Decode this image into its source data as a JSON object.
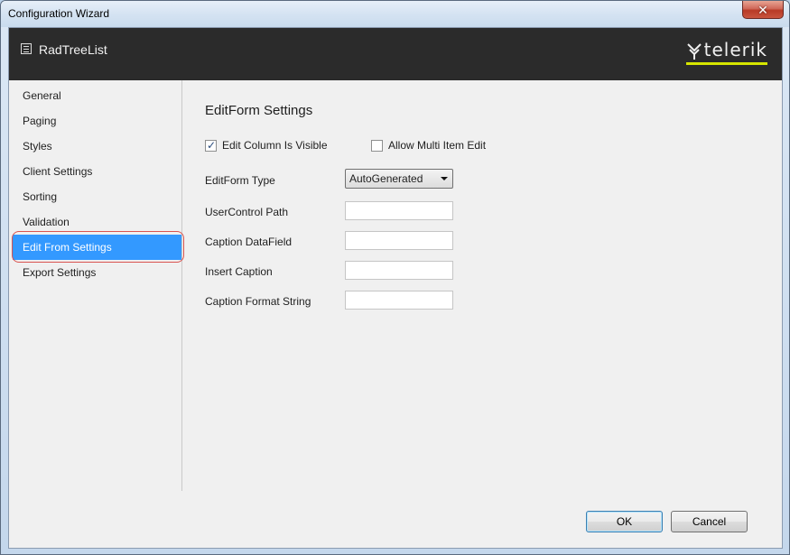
{
  "window": {
    "title": "Configuration Wizard",
    "close_symbol": "✕"
  },
  "header": {
    "title": "RadTreeList",
    "logo_text": "telerik",
    "icon": "list-icon",
    "accent_color": "#d6e600"
  },
  "sidebar": {
    "items": [
      {
        "label": "General"
      },
      {
        "label": "Paging"
      },
      {
        "label": "Styles"
      },
      {
        "label": "Client Settings"
      },
      {
        "label": "Sorting"
      },
      {
        "label": "Validation"
      },
      {
        "label": "Edit From Settings",
        "selected": true
      },
      {
        "label": "Export Settings"
      }
    ],
    "selected_color": "#3399ff"
  },
  "main": {
    "title": "EditForm Settings",
    "edit_column_visible": {
      "label": "Edit Column Is Visible",
      "checked": true
    },
    "allow_multi_item_edit": {
      "label": "Allow Multi Item Edit",
      "checked": false
    },
    "editform_type": {
      "label": "EditForm Type",
      "value": "AutoGenerated"
    },
    "usercontrol_path": {
      "label": "UserControl Path",
      "value": ""
    },
    "caption_datafield": {
      "label": "Caption DataField",
      "value": ""
    },
    "insert_caption": {
      "label": "Insert Caption",
      "value": ""
    },
    "caption_format_string": {
      "label": "Caption Format String",
      "value": ""
    }
  },
  "footer": {
    "ok_label": "OK",
    "cancel_label": "Cancel"
  }
}
